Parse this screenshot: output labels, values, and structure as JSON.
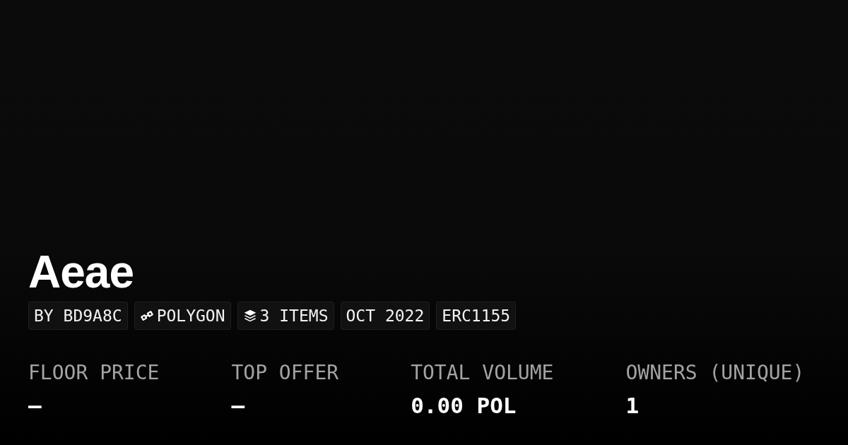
{
  "collection": {
    "title": "Aeae"
  },
  "tags": [
    {
      "label": "BY BD9A8C",
      "kind": "plain"
    },
    {
      "label": "POLYGON",
      "kind": "chain"
    },
    {
      "label": "3 ITEMS",
      "kind": "count"
    },
    {
      "label": "OCT 2022",
      "kind": "plain"
    },
    {
      "label": "ERC1155",
      "kind": "plain"
    }
  ],
  "stats": [
    {
      "label": "FLOOR PRICE",
      "value": "—"
    },
    {
      "label": "TOP OFFER",
      "value": "—"
    },
    {
      "label": "TOTAL VOLUME",
      "value": "0.00 POL"
    },
    {
      "label": "OWNERS (UNIQUE)",
      "value": "1"
    }
  ]
}
